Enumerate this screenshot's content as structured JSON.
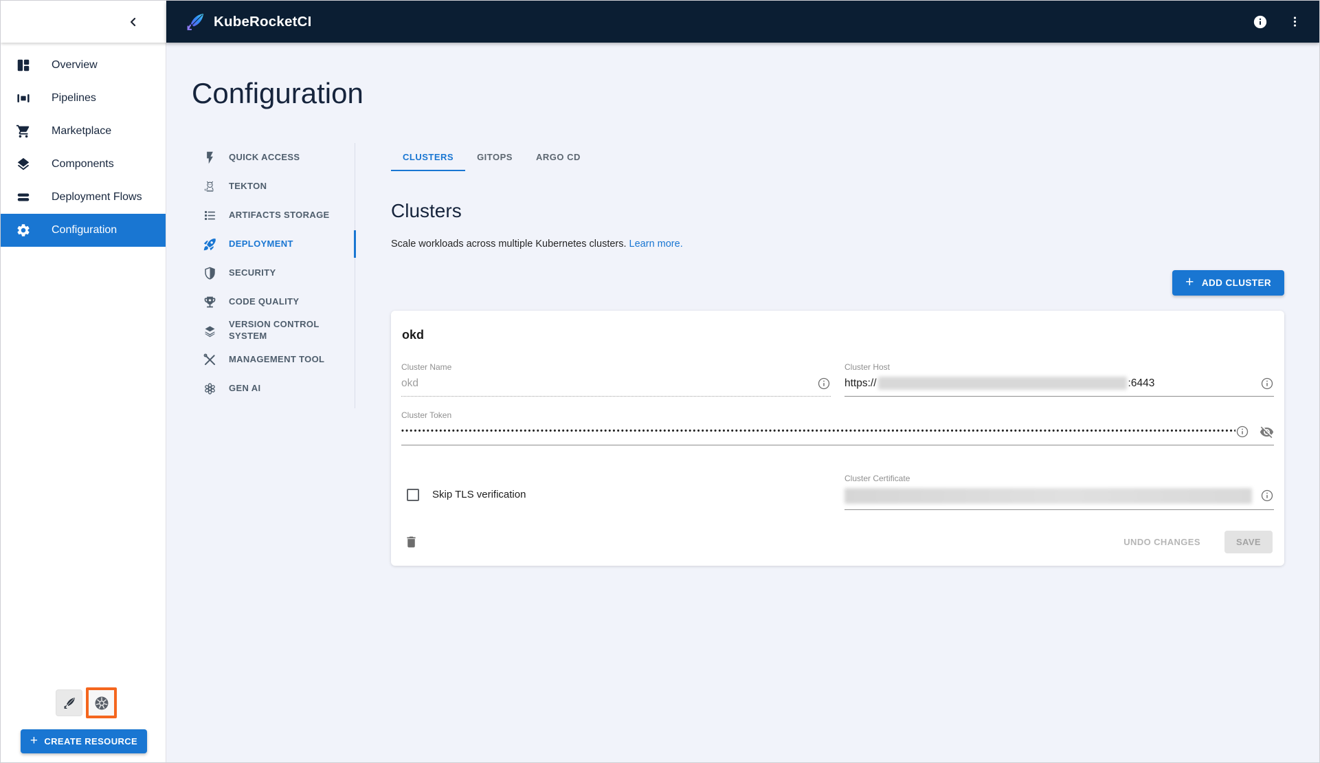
{
  "header": {
    "brand": "KubeRocketCI"
  },
  "sidebar": {
    "items": [
      {
        "label": "Overview"
      },
      {
        "label": "Pipelines"
      },
      {
        "label": "Marketplace"
      },
      {
        "label": "Components"
      },
      {
        "label": "Deployment Flows"
      },
      {
        "label": "Configuration",
        "active": true
      }
    ],
    "create_resource_label": "CREATE RESOURCE"
  },
  "page": {
    "title": "Configuration"
  },
  "section_nav": {
    "items": [
      {
        "label": "QUICK ACCESS"
      },
      {
        "label": "TEKTON"
      },
      {
        "label": "ARTIFACTS STORAGE"
      },
      {
        "label": "DEPLOYMENT",
        "active": true
      },
      {
        "label": "SECURITY"
      },
      {
        "label": "CODE QUALITY"
      },
      {
        "label": "VERSION CONTROL SYSTEM"
      },
      {
        "label": "MANAGEMENT TOOL"
      },
      {
        "label": "GEN AI"
      }
    ]
  },
  "tabs": {
    "items": [
      {
        "label": "CLUSTERS",
        "active": true
      },
      {
        "label": "GITOPS"
      },
      {
        "label": "ARGO CD"
      }
    ]
  },
  "clusters": {
    "heading": "Clusters",
    "description": "Scale workloads across multiple Kubernetes clusters.",
    "learn_more_label": "Learn more.",
    "add_cluster_label": "ADD CLUSTER",
    "card": {
      "title": "okd",
      "cluster_name": {
        "label": "Cluster Name",
        "value": "okd"
      },
      "cluster_host": {
        "label": "Cluster Host",
        "value_prefix": "https://",
        "value_suffix": ":6443",
        "redacted": true
      },
      "cluster_token": {
        "label": "Cluster Token",
        "masked_value": "••••••••••••••••••••••••••••••••••••••••••••••••••••••••••••••••••••••••••••••••••••••••••••••••••••••••••••••••••••••••••••••••••••••••••••••••••••••••••••••••••••••••••••••••••••••••••••••••••••••••••••••••••••••••••••••••••••••••••••••••"
      },
      "skip_tls": {
        "label": "Skip TLS verification",
        "checked": false
      },
      "cluster_certificate": {
        "label": "Cluster Certificate",
        "redacted": true
      },
      "undo_label": "UNDO CHANGES",
      "save_label": "SAVE"
    }
  },
  "colors": {
    "accent": "#1976d2",
    "header_bg": "#0b1e33",
    "highlight_border": "#f4661e"
  }
}
